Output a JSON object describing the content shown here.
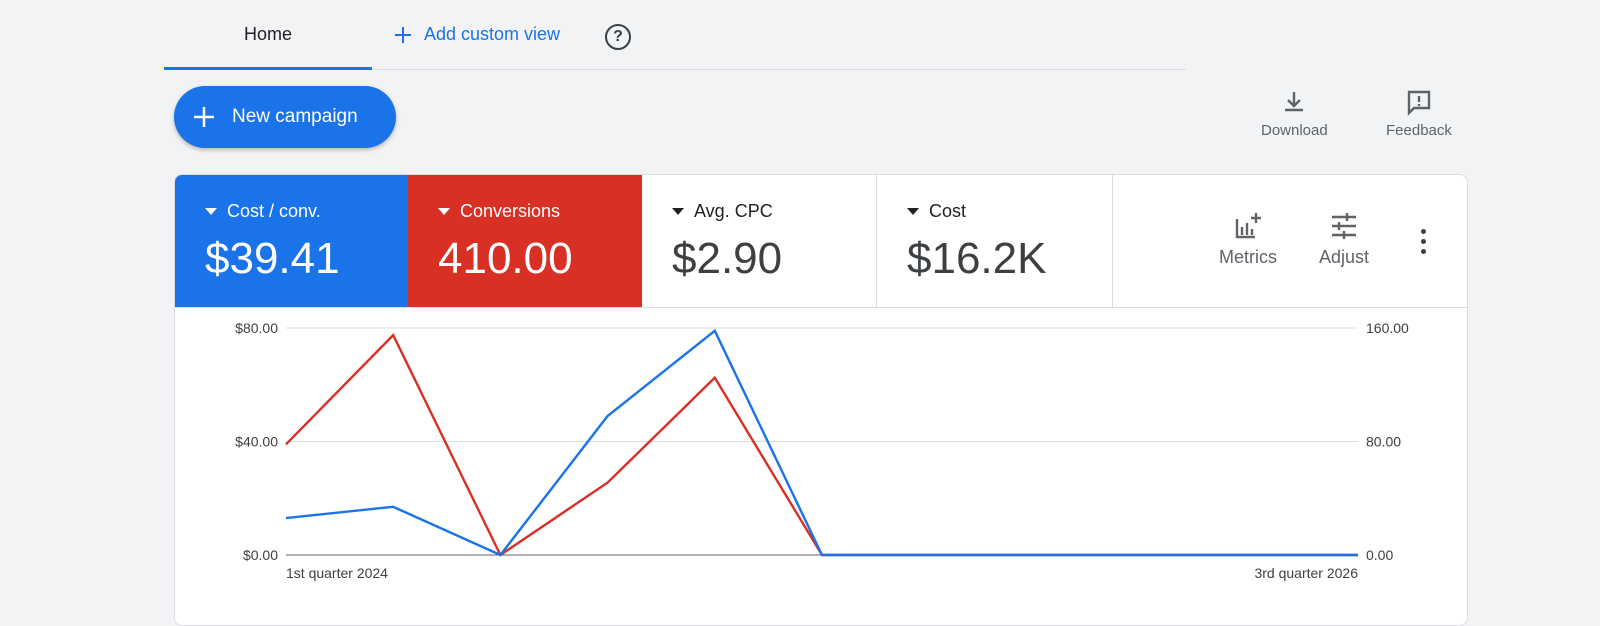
{
  "tabs": {
    "home": "Home",
    "add_custom_view": "Add custom view"
  },
  "toolbar": {
    "new_campaign": "New campaign",
    "download": "Download",
    "feedback": "Feedback"
  },
  "metrics": [
    {
      "label": "Cost / conv.",
      "value": "$39.41",
      "color": "#1a73e8"
    },
    {
      "label": "Conversions",
      "value": "410.00",
      "color": "#d93025"
    },
    {
      "label": "Avg. CPC",
      "value": "$2.90"
    },
    {
      "label": "Cost",
      "value": "$16.2K"
    }
  ],
  "chart_tools": {
    "metrics": "Metrics",
    "adjust": "Adjust"
  },
  "chart_data": {
    "type": "line",
    "x_start_label": "1st quarter 2024",
    "x_end_label": "3rd quarter 2026",
    "left_ticks": [
      {
        "value": 0,
        "label": "$0.00"
      },
      {
        "value": 40,
        "label": "$40.00"
      },
      {
        "value": 80,
        "label": "$80.00"
      }
    ],
    "right_ticks": [
      {
        "value": 0,
        "label": "0.00"
      },
      {
        "value": 80,
        "label": "80.00"
      },
      {
        "value": 160,
        "label": "160.00"
      }
    ],
    "left_ylim": [
      0,
      80
    ],
    "right_ylim": [
      0,
      160
    ],
    "series": [
      {
        "axis": "left",
        "color": "#1a73e8",
        "values": [
          13,
          17,
          0,
          49,
          79,
          0,
          0,
          0,
          0,
          0,
          0
        ]
      },
      {
        "axis": "right",
        "color": "#d93025",
        "values": [
          78,
          155,
          0,
          51,
          125,
          0,
          0,
          0,
          0,
          0,
          0
        ]
      }
    ]
  }
}
